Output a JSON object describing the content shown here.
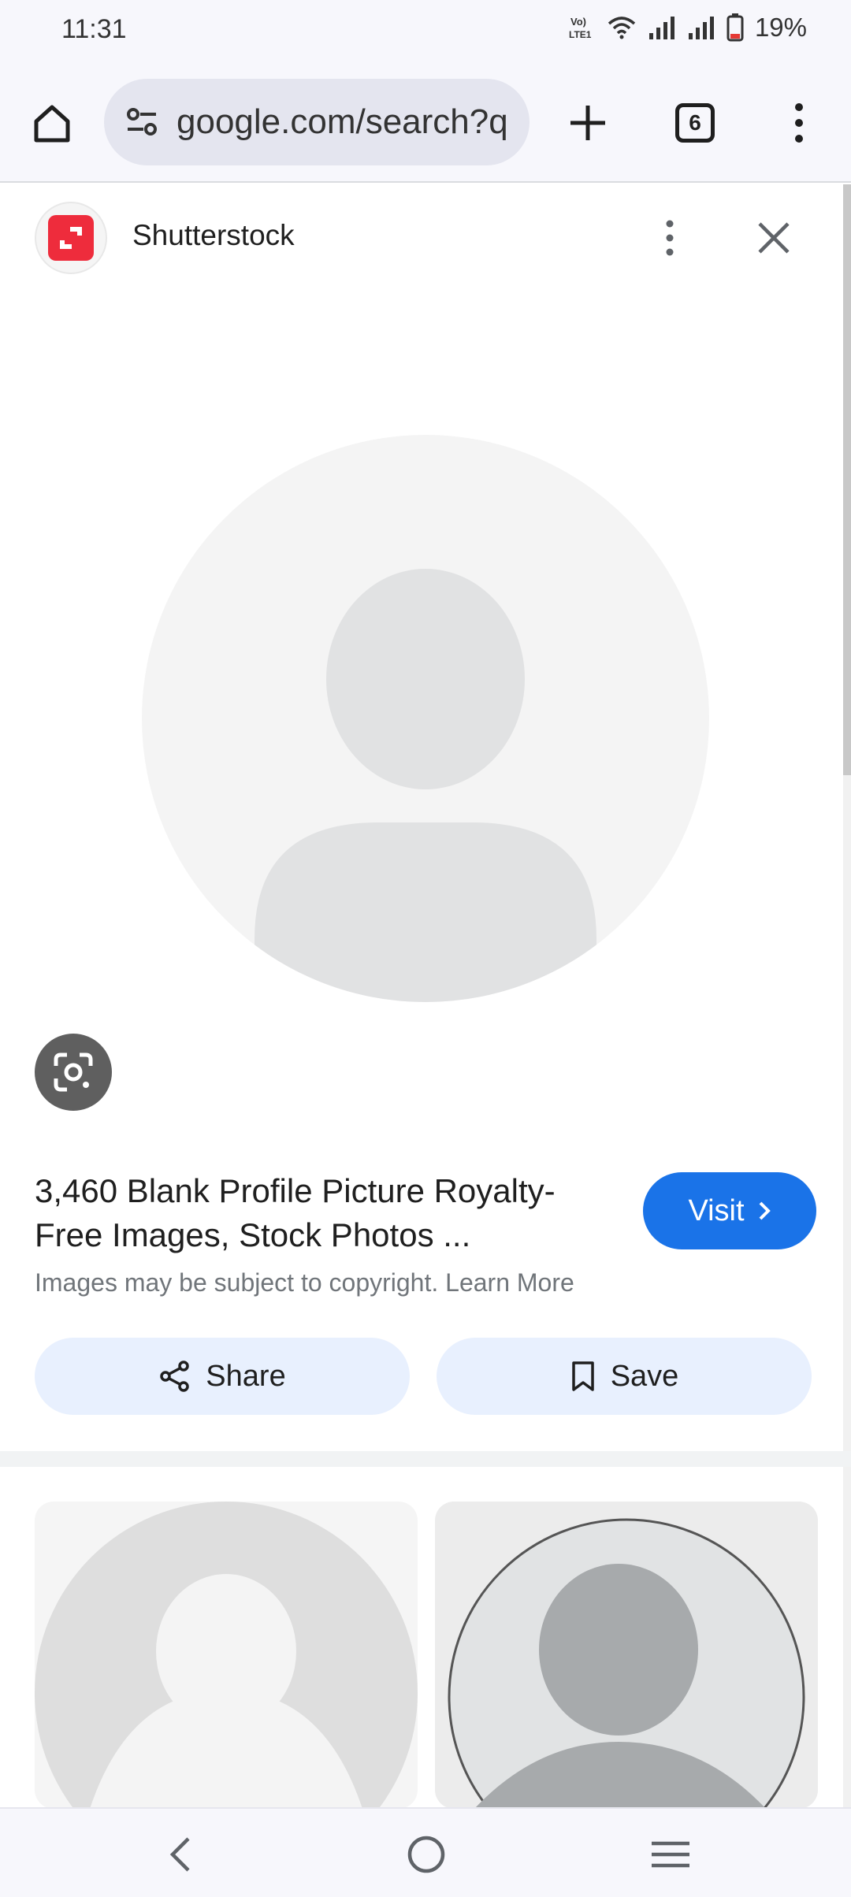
{
  "status_bar": {
    "time": "11:31",
    "battery_percent": "19%",
    "icons": [
      "volte-icon",
      "wifi-icon",
      "signal-icon",
      "signal-icon",
      "battery-icon"
    ]
  },
  "toolbar": {
    "url": "google.com/search?q",
    "tab_count": "6",
    "icons": [
      "home-icon",
      "site-settings-icon",
      "plus-icon",
      "more-vert-icon"
    ]
  },
  "panel": {
    "source_name": "Shutterstock",
    "title": "3,460 Blank Profile Picture Royalty-Free Images, Stock Photos ...",
    "visit_label": "Visit",
    "copyright_text": "Images may be subject to copyright. Learn More",
    "share_label": "Share",
    "save_label": "Save"
  },
  "nav": {
    "icons": [
      "back-icon",
      "home-circle-icon",
      "recents-icon"
    ]
  },
  "colors": {
    "accent": "#1a73e8",
    "brand_shutterstock": "#ee2c3c",
    "chip_bg": "#e8f0fe"
  }
}
